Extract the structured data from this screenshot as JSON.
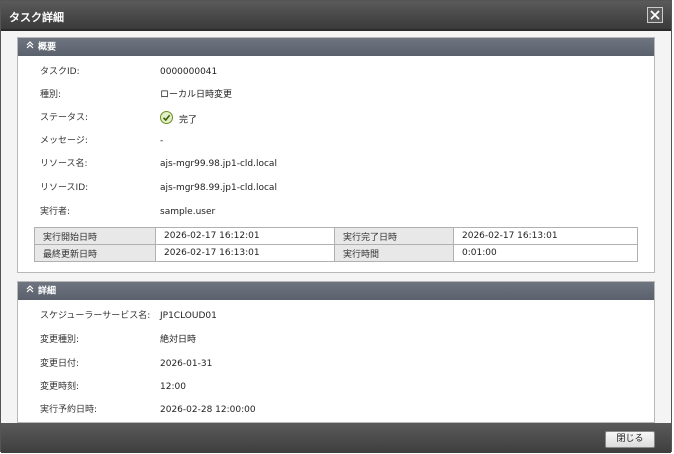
{
  "dialog": {
    "title": "タスク詳細"
  },
  "overview": {
    "header": "概要",
    "fields": [
      {
        "label": "タスクID:",
        "value": "0000000041"
      },
      {
        "label": "種別:",
        "value": "ローカル日時変更"
      },
      {
        "label": "ステータス:",
        "value": "完了"
      },
      {
        "label": "メッセージ:",
        "value": "-"
      },
      {
        "label": "リソース名:",
        "value": "ajs-mgr99.98.jp1-cld.local"
      },
      {
        "label": "リソースID:",
        "value": "ajs-mgr98.99.jp1-cld.local"
      },
      {
        "label": "実行者:",
        "value": "sample.user"
      }
    ],
    "times": [
      {
        "l1": "実行開始日時",
        "v1": "2026-02-17 16:12:01",
        "l2": "実行完了日時",
        "v2": "2026-02-17 16:13:01"
      },
      {
        "l1": "最終更新日時",
        "v1": "2026-02-17 16:13:01",
        "l2": "実行時間",
        "v2": "0:01:00"
      }
    ]
  },
  "details": {
    "header": "詳細",
    "fields": [
      {
        "label": "スケジューラーサービス名:",
        "value": "JP1CLOUD01"
      },
      {
        "label": "変更種別:",
        "value": "絶対日時"
      },
      {
        "label": "変更日付:",
        "value": "2026-01-31"
      },
      {
        "label": "変更時刻:",
        "value": "12:00"
      },
      {
        "label": "実行予約日時:",
        "value": "2026-02-28 12:00:00"
      }
    ]
  },
  "footer": {
    "close_label": "閉じる"
  },
  "colors": {
    "status_ok": "#6a8e1f",
    "header_bar": "#5f6570"
  },
  "icons": {
    "status": "check-circle-icon",
    "collapse": "chevron-up-double-icon",
    "close": "close-x-icon"
  }
}
